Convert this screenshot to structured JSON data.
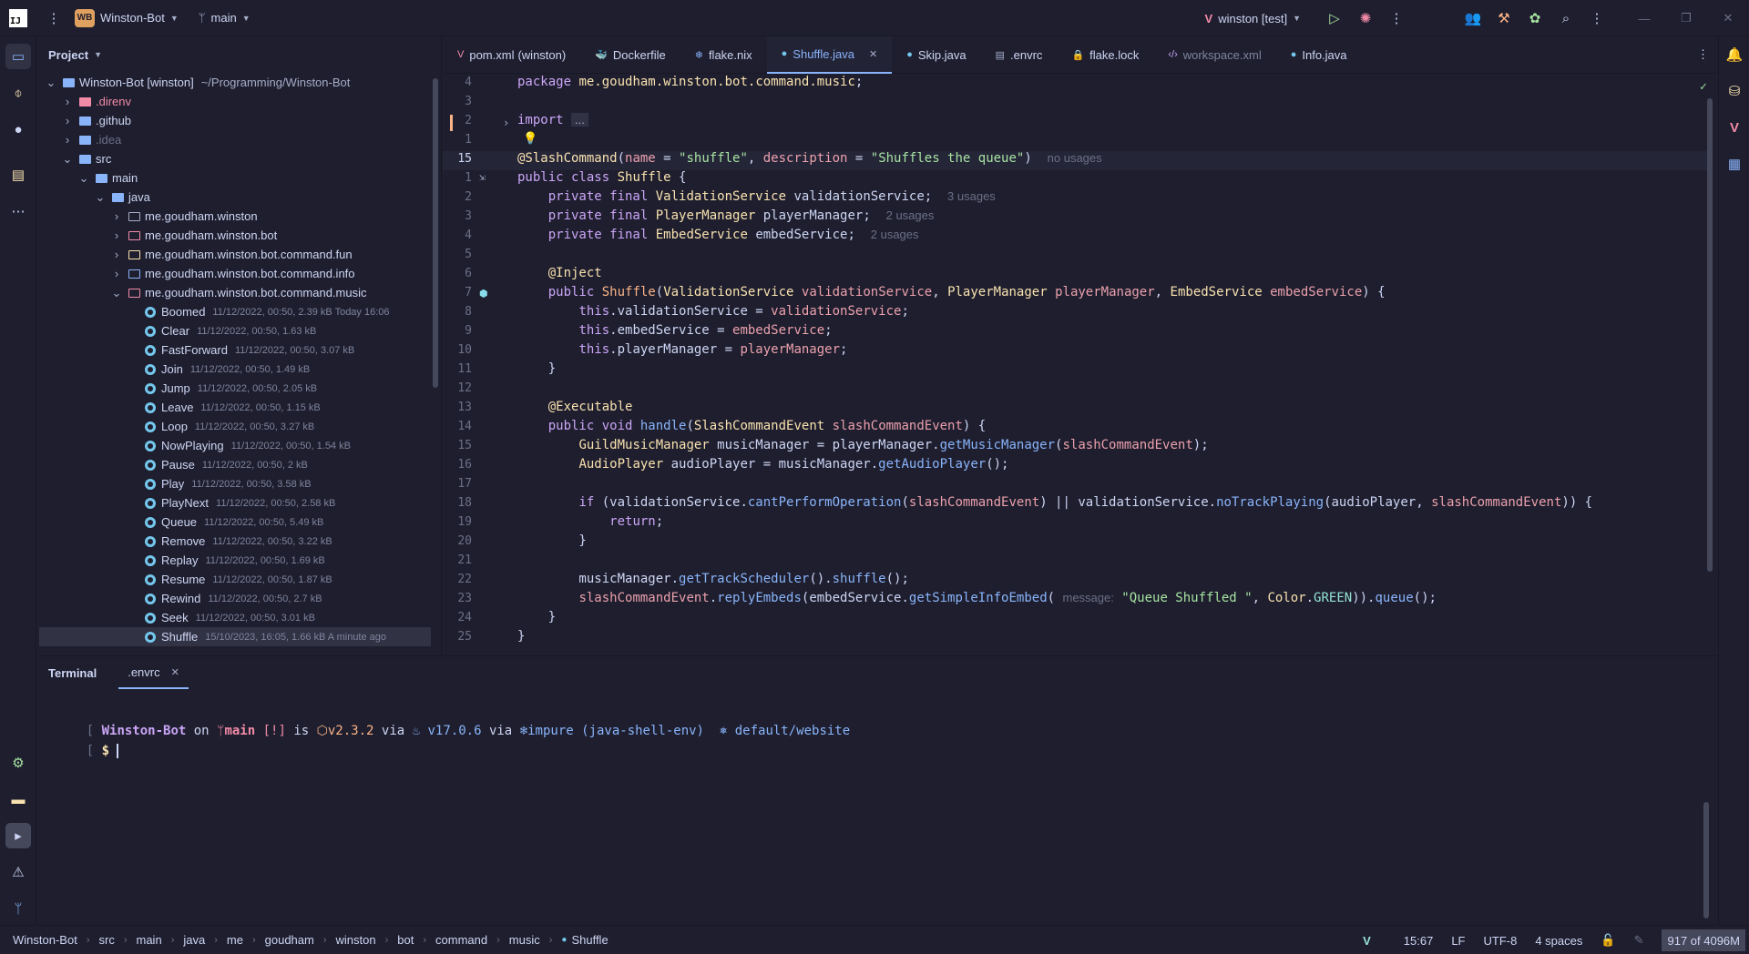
{
  "titlebar": {
    "project_badge": "WB",
    "project_name": "Winston-Bot",
    "branch": "main",
    "run_config": "winston [test]"
  },
  "project_panel": {
    "title": "Project",
    "tree": [
      {
        "label": "Winston-Bot [winston]",
        "meta": "~/Programming/Winston-Bot",
        "depth": 0,
        "open": true,
        "kind": "module"
      },
      {
        "label": ".direnv",
        "depth": 1,
        "open": false,
        "kind": "folder-red"
      },
      {
        "label": ".github",
        "depth": 1,
        "open": false,
        "kind": "folder"
      },
      {
        "label": ".idea",
        "depth": 1,
        "open": false,
        "kind": "folder"
      },
      {
        "label": "src",
        "depth": 1,
        "open": true,
        "kind": "folder"
      },
      {
        "label": "main",
        "depth": 2,
        "open": true,
        "kind": "folder"
      },
      {
        "label": "java",
        "depth": 3,
        "open": true,
        "kind": "folder-src"
      },
      {
        "label": "me.goudham.winston",
        "depth": 4,
        "open": false,
        "kind": "package"
      },
      {
        "label": "me.goudham.winston.bot",
        "depth": 4,
        "open": false,
        "kind": "package-red"
      },
      {
        "label": "me.goudham.winston.bot.command.fun",
        "depth": 4,
        "open": false,
        "kind": "package-yellow"
      },
      {
        "label": "me.goudham.winston.bot.command.info",
        "depth": 4,
        "open": false,
        "kind": "package-blue"
      },
      {
        "label": "me.goudham.winston.bot.command.music",
        "depth": 4,
        "open": true,
        "kind": "package-red"
      },
      {
        "label": "Boomed",
        "meta": "11/12/2022, 00:50, 2.39 kB Today 16:06",
        "depth": 5,
        "kind": "class"
      },
      {
        "label": "Clear",
        "meta": "11/12/2022, 00:50, 1.63 kB",
        "depth": 5,
        "kind": "class"
      },
      {
        "label": "FastForward",
        "meta": "11/12/2022, 00:50, 3.07 kB",
        "depth": 5,
        "kind": "class"
      },
      {
        "label": "Join",
        "meta": "11/12/2022, 00:50, 1.49 kB",
        "depth": 5,
        "kind": "class"
      },
      {
        "label": "Jump",
        "meta": "11/12/2022, 00:50, 2.05 kB",
        "depth": 5,
        "kind": "class"
      },
      {
        "label": "Leave",
        "meta": "11/12/2022, 00:50, 1.15 kB",
        "depth": 5,
        "kind": "class"
      },
      {
        "label": "Loop",
        "meta": "11/12/2022, 00:50, 3.27 kB",
        "depth": 5,
        "kind": "class"
      },
      {
        "label": "NowPlaying",
        "meta": "11/12/2022, 00:50, 1.54 kB",
        "depth": 5,
        "kind": "class"
      },
      {
        "label": "Pause",
        "meta": "11/12/2022, 00:50, 2 kB",
        "depth": 5,
        "kind": "class"
      },
      {
        "label": "Play",
        "meta": "11/12/2022, 00:50, 3.58 kB",
        "depth": 5,
        "kind": "class"
      },
      {
        "label": "PlayNext",
        "meta": "11/12/2022, 00:50, 2.58 kB",
        "depth": 5,
        "kind": "class"
      },
      {
        "label": "Queue",
        "meta": "11/12/2022, 00:50, 5.49 kB",
        "depth": 5,
        "kind": "class"
      },
      {
        "label": "Remove",
        "meta": "11/12/2022, 00:50, 3.22 kB",
        "depth": 5,
        "kind": "class"
      },
      {
        "label": "Replay",
        "meta": "11/12/2022, 00:50, 1.69 kB",
        "depth": 5,
        "kind": "class"
      },
      {
        "label": "Resume",
        "meta": "11/12/2022, 00:50, 1.87 kB",
        "depth": 5,
        "kind": "class"
      },
      {
        "label": "Rewind",
        "meta": "11/12/2022, 00:50, 2.7 kB",
        "depth": 5,
        "kind": "class"
      },
      {
        "label": "Seek",
        "meta": "11/12/2022, 00:50, 3.01 kB",
        "depth": 5,
        "kind": "class"
      },
      {
        "label": "Shuffle",
        "meta": "15/10/2023, 16:05, 1.66 kB A minute ago",
        "depth": 5,
        "kind": "class",
        "selected": true
      }
    ]
  },
  "tabs": [
    {
      "label": "pom.xml",
      "suffix": "(winston)",
      "icon": "maven-icon"
    },
    {
      "label": "Dockerfile",
      "icon": "docker-icon"
    },
    {
      "label": "flake.nix",
      "icon": "nix-icon"
    },
    {
      "label": "Shuffle.java",
      "icon": "java-class-icon",
      "active": true
    },
    {
      "label": "Skip.java",
      "icon": "java-class-icon"
    },
    {
      "label": ".envrc",
      "icon": "file-icon"
    },
    {
      "label": "flake.lock",
      "icon": "lock-icon"
    },
    {
      "label": "workspace.xml",
      "icon": "xml-icon",
      "dim": true
    },
    {
      "label": "Info.java",
      "icon": "java-class-icon"
    }
  ],
  "editor": {
    "line_numbers": [
      "4",
      "3",
      "2",
      "1",
      "15",
      "1",
      "2",
      "3",
      "4",
      "5",
      "6",
      "7",
      "8",
      "9",
      "10",
      "11",
      "12",
      "13",
      "14",
      "15",
      "16",
      "17",
      "18",
      "19",
      "20",
      "21",
      "22",
      "23",
      "24",
      "25"
    ],
    "hints": {
      "no_usages": "no usages",
      "usages3": "3 usages",
      "usages2a": "2 usages",
      "usages2b": "2 usages",
      "param_message": "message:",
      "import_fold": "..."
    }
  },
  "terminal": {
    "tabs": [
      "Terminal",
      ".envrc"
    ],
    "prompt": {
      "dir": "Winston-Bot",
      "on": "on",
      "branch": "main",
      "status": "[!]",
      "is": "is",
      "pkg": "v2.3.2",
      "via1": "via",
      "java": "v17.0.6",
      "via2": "via",
      "nix": "impure (java-shell-env)",
      "k8s": "default/website",
      "symbol": "$"
    }
  },
  "statusbar": {
    "breadcrumb": [
      "Winston-Bot",
      "src",
      "main",
      "java",
      "me",
      "goudham",
      "winston",
      "bot",
      "command",
      "music",
      "Shuffle"
    ],
    "position": "15:67",
    "line_sep": "LF",
    "encoding": "UTF-8",
    "indent": "4 spaces",
    "memory": "917 of 4096M"
  },
  "colors": {
    "background": "#1e1e2e",
    "accent": "#89b4fa",
    "keyword": "#cba6f7",
    "string": "#a6e3a1",
    "type": "#f9e2af"
  }
}
